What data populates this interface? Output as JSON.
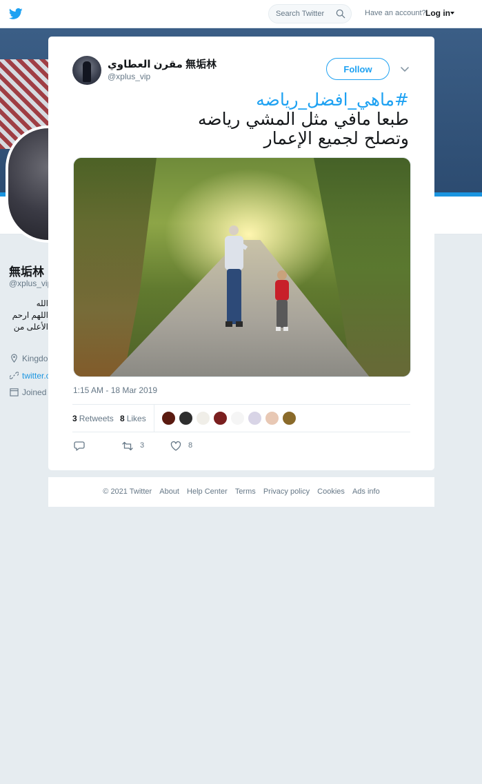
{
  "nav": {
    "search_placeholder": "Search Twitter",
    "have_account": "Have an account?",
    "login_label": "Log in",
    "brand_color": "#1da1f2"
  },
  "background_profile": {
    "name": "無垢林",
    "handle": "@xplus_vip",
    "bio_lines": [
      "الله",
      "اللهم ارحم",
      "الأعلى من"
    ],
    "location": "Kingdo",
    "url": "twitter.c",
    "joined": "Joined"
  },
  "tweet": {
    "display_name": "مقرن العطاوي 無垢林",
    "screen_name": "@xplus_vip",
    "follow_label": "Follow",
    "hashtag": "#ماهي_افضل_رياضه",
    "text_line_1": "طبعا مافي مثل المشي رياضه",
    "text_line_2": "وتصلح لجميع الإعمار",
    "timestamp": "1:15 AM - 18 Mar 2019",
    "retweets_count": "3",
    "retweets_label": "Retweets",
    "likes_count": "8",
    "likes_label": "Likes",
    "action_retweet_count": "3",
    "action_like_count": "8",
    "liker_avatar_colors": [
      "#5a1a10",
      "#2e2e2e",
      "#f0eee8",
      "#7a1f1f",
      "#f5f5f5",
      "#d8d4e6",
      "#e8c8b4",
      "#8a6a2a"
    ]
  },
  "footer": {
    "copyright": "© 2021 Twitter",
    "links": [
      "About",
      "Help Center",
      "Terms",
      "Privacy policy",
      "Cookies",
      "Ads info"
    ]
  }
}
